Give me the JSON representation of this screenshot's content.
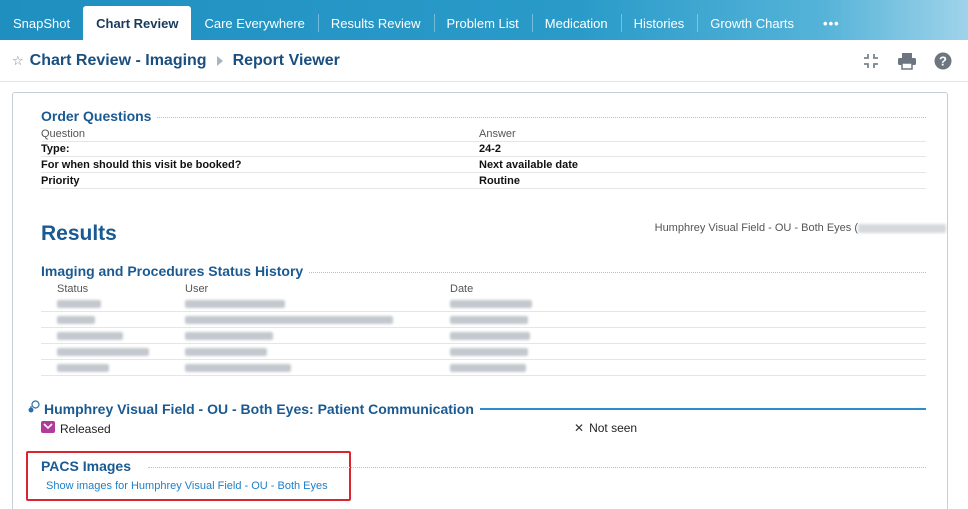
{
  "tabs": [
    {
      "label": "SnapShot",
      "active": false
    },
    {
      "label": "Chart Review",
      "active": true
    },
    {
      "label": "Care Everywhere",
      "active": false
    },
    {
      "label": "Results Review",
      "active": false
    },
    {
      "label": "Problem List",
      "active": false
    },
    {
      "label": "Medication",
      "active": false
    },
    {
      "label": "Histories",
      "active": false
    },
    {
      "label": "Growth Charts",
      "active": false
    },
    {
      "label": "•••",
      "active": false
    }
  ],
  "titlebar": {
    "title": "Chart Review - Imaging",
    "subtitle": "Report Viewer",
    "icons": [
      "collapse-icon",
      "print-icon",
      "help-icon"
    ]
  },
  "order_questions": {
    "heading": "Order Questions",
    "col_question": "Question",
    "col_answer": "Answer",
    "rows": [
      {
        "question": "Type:",
        "answer": "24-2"
      },
      {
        "question": "For when should this visit be booked?",
        "answer": "Next available date"
      },
      {
        "question": "Priority",
        "answer": "Routine"
      }
    ]
  },
  "results": {
    "heading": "Results",
    "exam": "Humphrey Visual Field - OU - Both Eyes ("
  },
  "status_history": {
    "heading": "Imaging and Procedures Status History",
    "col_status": "Status",
    "col_user": "User",
    "col_date": "Date"
  },
  "communication": {
    "heading": "Humphrey Visual Field - OU - Both Eyes: Patient Communication",
    "released_label": "Released",
    "not_seen_label": "Not seen"
  },
  "pacs": {
    "heading": "PACS Images",
    "link": "Show images for Humphrey Visual Field - OU - Both Eyes"
  },
  "colors": {
    "accent": "#1a5a92",
    "tabbar": "#2a9bc9",
    "highlight_border": "#d9262f",
    "link": "#1e7fc6"
  }
}
